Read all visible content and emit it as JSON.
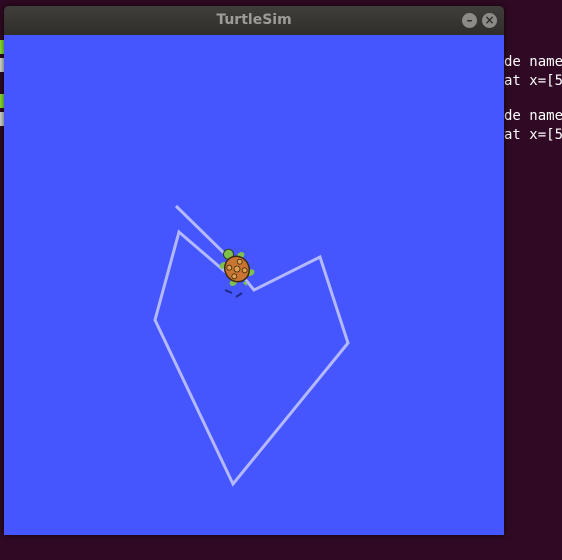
{
  "window": {
    "title": "TurtleSim",
    "minimize_icon": "minimize-icon",
    "close_icon": "close-icon",
    "background_color": "#4556ff",
    "pen_color": "#b3b8ff"
  },
  "terminal": {
    "lines": [
      "de name",
      "at x=[5",
      "de name",
      "at x=[5"
    ]
  }
}
